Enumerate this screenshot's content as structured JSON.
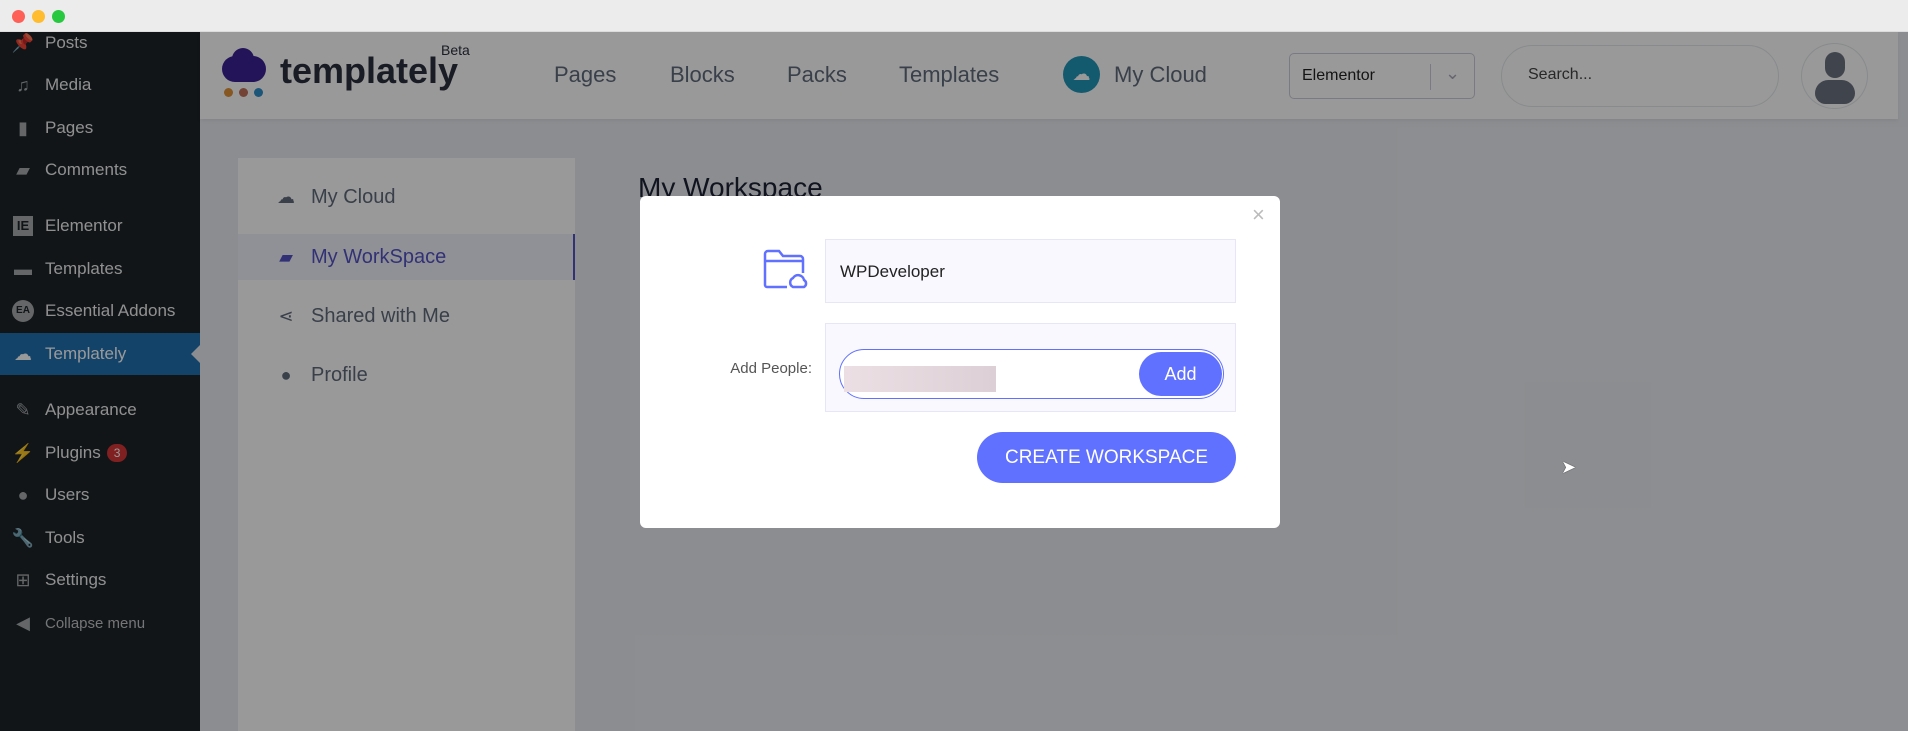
{
  "window": {
    "controls": [
      "close",
      "minimize",
      "maximize"
    ]
  },
  "wp_sidebar": {
    "items": [
      {
        "label": "Posts",
        "icon": "pin-icon"
      },
      {
        "label": "Media",
        "icon": "media-icon"
      },
      {
        "label": "Pages",
        "icon": "pages-icon"
      },
      {
        "label": "Comments",
        "icon": "comment-icon"
      },
      {
        "label": "Elementor",
        "icon": "elementor-icon"
      },
      {
        "label": "Templates",
        "icon": "folder-icon"
      },
      {
        "label": "Essential Addons",
        "icon": "ea-icon"
      },
      {
        "label": "Templately",
        "icon": "templately-icon",
        "active": true
      },
      {
        "label": "Appearance",
        "icon": "brush-icon"
      },
      {
        "label": "Plugins",
        "icon": "plugin-icon",
        "badge": "3"
      },
      {
        "label": "Users",
        "icon": "user-icon"
      },
      {
        "label": "Tools",
        "icon": "wrench-icon"
      },
      {
        "label": "Settings",
        "icon": "settings-icon"
      },
      {
        "label": "Collapse menu",
        "icon": "collapse-icon"
      }
    ]
  },
  "header": {
    "logo_text": "templately",
    "logo_badge": "Beta",
    "nav": [
      "Pages",
      "Blocks",
      "Packs",
      "Templates"
    ],
    "my_cloud": "My Cloud",
    "builder_select": "Elementor",
    "search_placeholder": "Search..."
  },
  "left_panel": {
    "items": [
      {
        "label": "My Cloud",
        "icon": "cloud-icon"
      },
      {
        "label": "My WorkSpace",
        "icon": "folder-open-icon",
        "active": true
      },
      {
        "label": "Shared with Me",
        "icon": "share-icon"
      },
      {
        "label": "Profile",
        "icon": "user-icon"
      }
    ]
  },
  "main": {
    "heading": "My Workspace"
  },
  "modal": {
    "workspace_name": "WPDeveloper",
    "add_people_label": "Add People:",
    "add_button": "Add",
    "create_button": "CREATE WORKSPACE",
    "accent": "#6070ff"
  }
}
